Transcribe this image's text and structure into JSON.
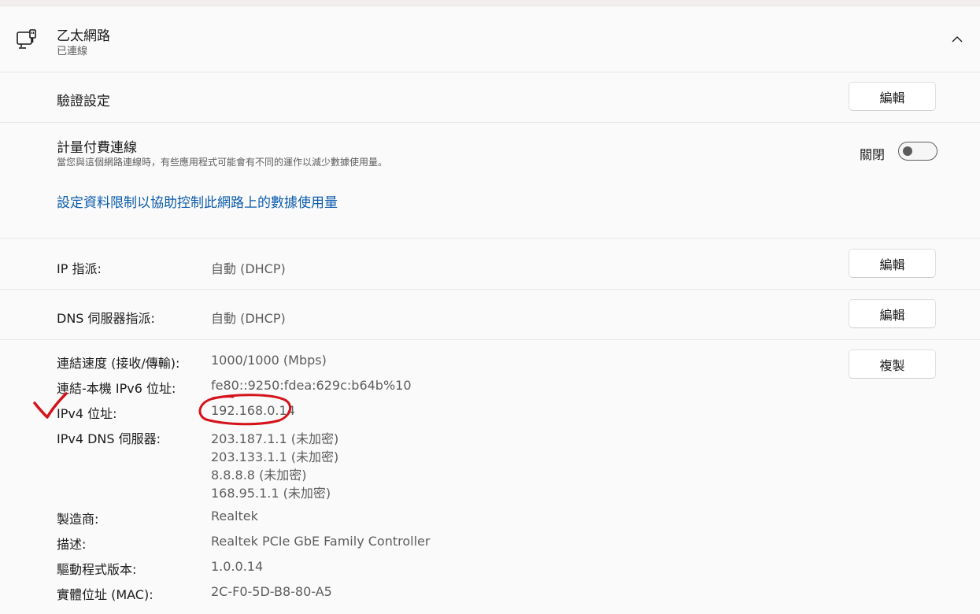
{
  "header": {
    "title": "乙太網路",
    "status": "已連線",
    "icon": "ethernet-icon",
    "chevron_icon": "chevron-up-icon"
  },
  "auth": {
    "label": "驗證設定",
    "button": "編輯"
  },
  "metered": {
    "title": "計量付費連線",
    "description": "當您與這個網路連線時，有些應用程式可能會有不同的運作以減少數據使用量。",
    "toggle_label": "關閉",
    "toggle_on": false,
    "link": "設定資料限制以協助控制此網路上的數據使用量"
  },
  "ip_assign": {
    "label": "IP 指派:",
    "value": "自動 (DHCP)",
    "button": "編輯"
  },
  "dns_assign": {
    "label": "DNS 伺服器指派:",
    "value": "自動 (DHCP)",
    "button": "編輯"
  },
  "copy_button": "複製",
  "properties": [
    {
      "label": "連結速度 (接收/傳輸):",
      "values": [
        "1000/1000 (Mbps)"
      ]
    },
    {
      "label": "連結-本機 IPv6 位址:",
      "values": [
        "fe80::9250:fdea:629c:b64b%10"
      ]
    },
    {
      "label": "IPv4 位址:",
      "values": [
        "192.168.0.14"
      ]
    },
    {
      "label": "IPv4 DNS 伺服器:",
      "values": [
        "203.187.1.1 (未加密)",
        "203.133.1.1 (未加密)",
        "8.8.8.8 (未加密)",
        "168.95.1.1 (未加密)"
      ]
    },
    {
      "label": "製造商:",
      "values": [
        "Realtek"
      ]
    },
    {
      "label": "描述:",
      "values": [
        "Realtek PCIe GbE Family Controller"
      ]
    },
    {
      "label": "驅動程式版本:",
      "values": [
        "1.0.0.14"
      ]
    },
    {
      "label": "實體位址 (MAC):",
      "values": [
        "2C-F0-5D-B8-80-A5"
      ]
    }
  ],
  "colors": {
    "link": "#0b5cad",
    "annotation": "#d4141c"
  }
}
